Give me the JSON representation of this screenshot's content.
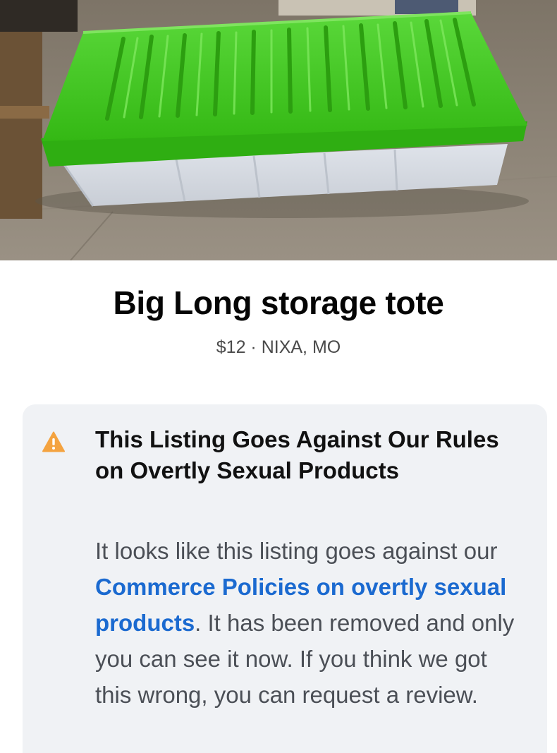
{
  "listing": {
    "title": "Big Long storage tote",
    "price": "$12",
    "separator": " · ",
    "location": "NIXA, MO"
  },
  "notice": {
    "icon": "warning-triangle-icon",
    "heading": "This Listing Goes Against Our Rules on Overtly Sexual Products",
    "body_before": "It looks like this listing goes against our ",
    "link_text": "Commerce Policies on overtly sexual products",
    "body_after": ". It has been removed and only you can see it now. If you think we got this wrong, you can request a review."
  },
  "colors": {
    "accent_link": "#1b6ad0",
    "warning": "#f4a340",
    "lid_green": "#3ec41a",
    "notice_bg": "#f0f2f5"
  }
}
